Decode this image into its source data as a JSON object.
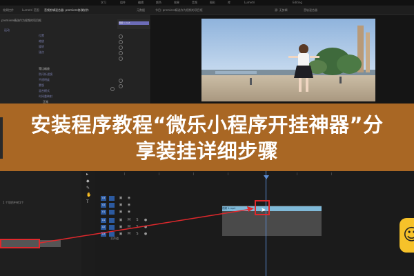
{
  "menubar": {
    "items": [
      "学习",
      "组件",
      "编辑",
      "颜色",
      "效果",
      "音频",
      "图形",
      "库",
      "Lumetri",
      "Editing"
    ]
  },
  "tabs": [
    {
      "label": "效果控件",
      "active": false
    },
    {
      "label": "Lumetri 范围",
      "active": false
    },
    {
      "label": "音频剪辑混合器: premiere修改制作",
      "active": true
    },
    {
      "label": "元数据",
      "active": false
    },
    {
      "label": "节目: premiere精选作为视频的项目框",
      "active": false
    },
    {
      "label": "源: 无剪辑",
      "active": false
    },
    {
      "label": "音轨混合器",
      "active": false
    }
  ],
  "left_panel": {
    "header": "premiere精选作为视频的项目框",
    "mini_clip_label": "视频 1.mp4",
    "rows": [
      "运动",
      "位置",
      "缩放",
      "旋转",
      "锚点",
      "防闪烁滤镜",
      "不透明度",
      "蒙版",
      "混合模式",
      "时间重映射",
      "等比缩放",
      "正常"
    ]
  },
  "banner": {
    "title": "安装程序教程“微乐小程序开挂神器”分享装挂详细步骤"
  },
  "project_panel": {
    "label": "1 个项目中的1个"
  },
  "timeline": {
    "clip_label": "视频 1.mp4",
    "track_labels": [
      "V3",
      "V2",
      "V1",
      "A1",
      "A2",
      "A3"
    ],
    "bottom_label": "主声道"
  },
  "colors": {
    "banner": "#b56e26",
    "highlight": "#e0282c",
    "playhead": "#5b8dd6",
    "clip": "#7fb9d8"
  },
  "icons": [
    "reset-icon",
    "selection-tool-icon",
    "razor-tool-icon",
    "pen-tool-icon",
    "hand-tool-icon",
    "text-tool-icon",
    "cursor-icon",
    "mascot-icon"
  ]
}
